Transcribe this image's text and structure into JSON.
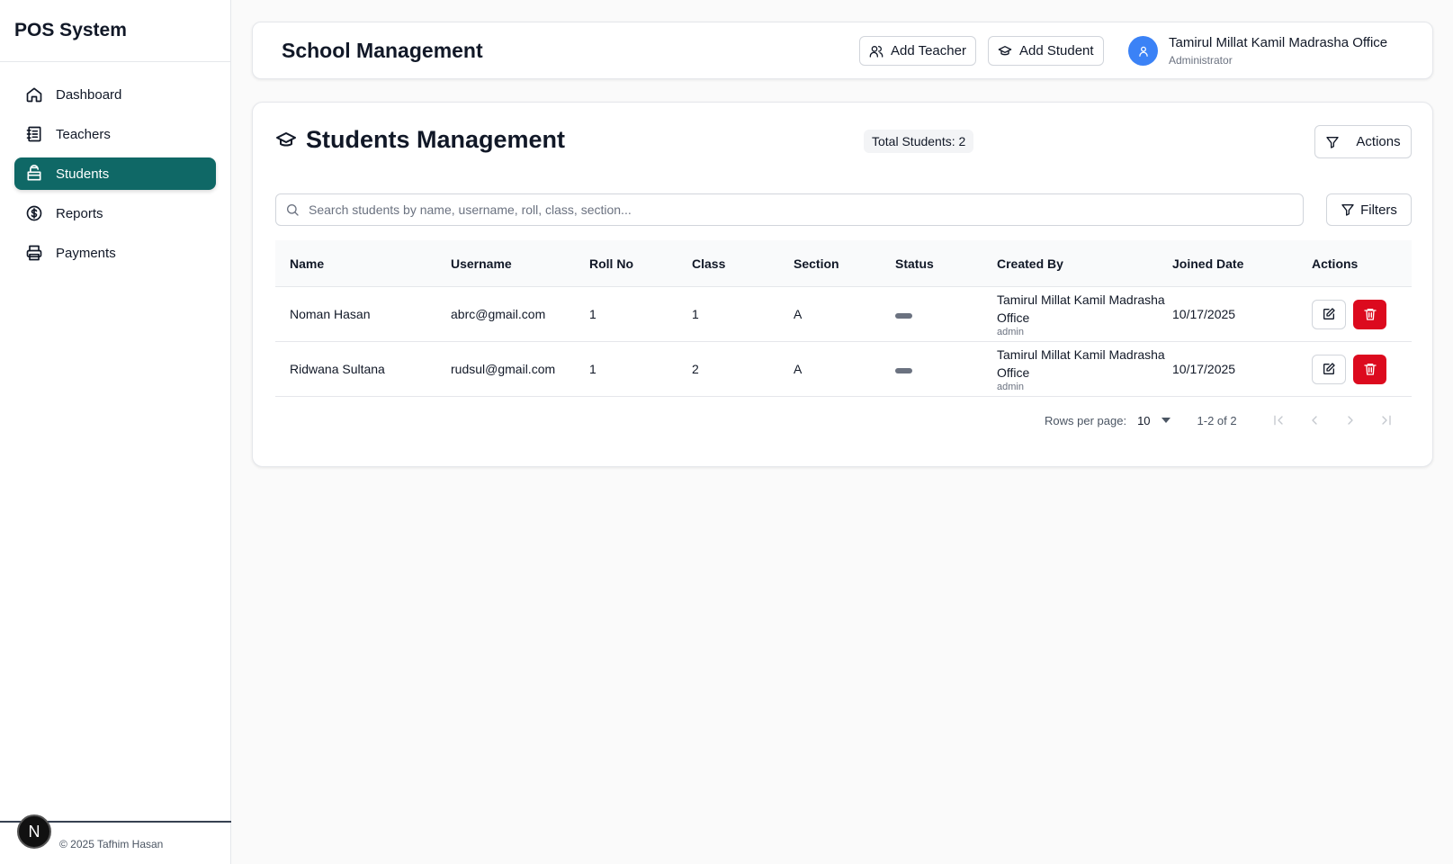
{
  "app": {
    "title": "POS System"
  },
  "sidebar": {
    "items": [
      {
        "label": "Dashboard",
        "icon": "home-icon"
      },
      {
        "label": "Teachers",
        "icon": "notebook-icon"
      },
      {
        "label": "Students",
        "icon": "backpack-icon",
        "active": true
      },
      {
        "label": "Reports",
        "icon": "dollar-circle-icon"
      },
      {
        "label": "Payments",
        "icon": "printer-icon"
      }
    ],
    "footer": "© 2025 Tafhim Hasan",
    "badge": "N"
  },
  "header": {
    "title": "School Management",
    "add_teacher": "Add Teacher",
    "add_student": "Add Student",
    "user_name": "Tamirul Millat Kamil Madrasha Office",
    "user_role": "Administrator"
  },
  "main": {
    "title": "Students Management",
    "total_label": "Total Students: 2",
    "actions_label": "Actions",
    "search_placeholder": "Search students by name, username, roll, class, section...",
    "filters_label": "Filters"
  },
  "table": {
    "columns": [
      "Name",
      "Username",
      "Roll No",
      "Class",
      "Section",
      "Status",
      "Created By",
      "Joined Date",
      "Actions"
    ],
    "rows": [
      {
        "name": "Noman Hasan",
        "username": "abrc@gmail.com",
        "roll": "1",
        "class": "1",
        "section": "A",
        "created_by": "Tamirul Millat Kamil Madrasha Office",
        "created_role": "admin",
        "joined": "10/17/2025"
      },
      {
        "name": "Ridwana Sultana",
        "username": "rudsul@gmail.com",
        "roll": "1",
        "class": "2",
        "section": "A",
        "created_by": "Tamirul Millat Kamil Madrasha Office",
        "created_role": "admin",
        "joined": "10/17/2025"
      }
    ]
  },
  "pagination": {
    "rows_per_page_label": "Rows per page:",
    "rows_per_page": "10",
    "range": "1-2 of 2"
  },
  "colors": {
    "accent": "#0f6866",
    "danger": "#dc0a1e",
    "avatar": "#3b82f6"
  }
}
